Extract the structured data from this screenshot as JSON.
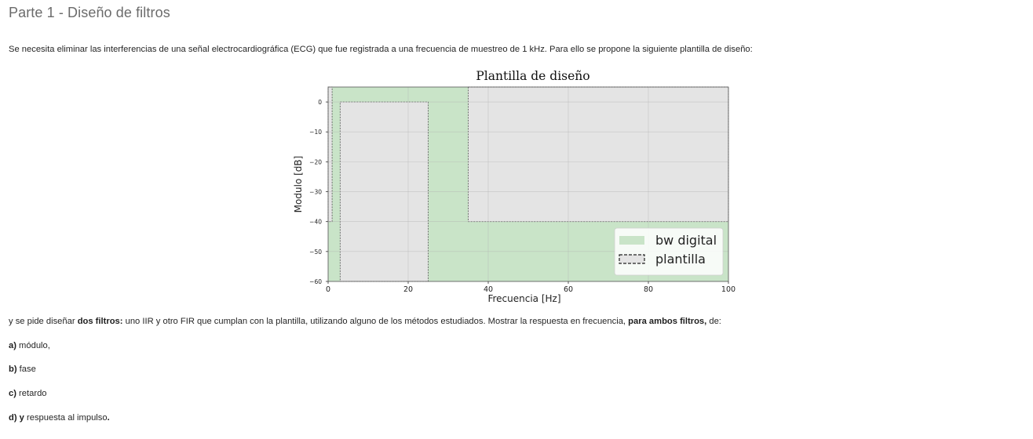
{
  "page": {
    "title": "Parte 1 - Diseño de filtros",
    "intro": "Se necesita eliminar las interferencias de una señal electrocardiográfica (ECG) que fue registrada a una frecuencia de muestreo de 1 kHz. Para ello se propone la siguiente plantilla de diseño:",
    "task": {
      "before": "y se pide diseñar ",
      "bold1": "dos filtros:",
      "middle": " uno IIR y otro FIR que cumplan con la plantilla, utilizando alguno de los métodos estudiados. Mostrar la respuesta en frecuencia, ",
      "bold2": "para ambos filtros,",
      "after": " de:"
    },
    "items": [
      {
        "label": "a)",
        "text": " módulo,"
      },
      {
        "label": "b)",
        "text": " fase"
      },
      {
        "label": "c)",
        "text": " retardo"
      },
      {
        "label": "d) y",
        "text": " respuesta al impulso",
        "suffix": "."
      }
    ]
  },
  "chart_data": {
    "type": "area",
    "title": "Plantilla de diseño",
    "xlabel": "Frecuencia [Hz]",
    "ylabel": "Modulo [dB]",
    "xlim": [
      0,
      100
    ],
    "ylim": [
      -60,
      5
    ],
    "xticks": [
      0,
      20,
      40,
      60,
      80,
      100
    ],
    "yticks": [
      0,
      -10,
      -20,
      -30,
      -40,
      -50,
      -60
    ],
    "grid": true,
    "legend_placement": "lower-right",
    "background_color": "#ffffff",
    "series": [
      {
        "name": "bw digital",
        "kind": "band",
        "color": "#c9e4c8",
        "x": [
          0,
          100
        ],
        "y_low": [
          -60,
          -60
        ],
        "y_high": [
          5,
          5
        ]
      },
      {
        "name": "plantilla",
        "kind": "stop-regions",
        "color": "#e4e4e4",
        "regions": [
          {
            "x0": 0,
            "x1": 1,
            "y0": -40,
            "y1": 5
          },
          {
            "x0": 3,
            "x1": 25,
            "y0": -60,
            "y1": 0
          },
          {
            "x0": 35,
            "x1": 100,
            "y0": -40,
            "y1": 5
          }
        ]
      }
    ]
  }
}
